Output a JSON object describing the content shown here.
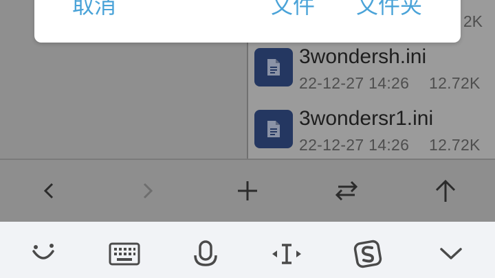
{
  "dialog": {
    "cancel_label": "取消",
    "file_label": "文件",
    "folder_label": "文件夹"
  },
  "file_list": {
    "partial_size": "2K",
    "items": [
      {
        "name": "3wondersh.ini",
        "date": "22-12-27 14:26",
        "size": "12.72K",
        "icon": "document-icon"
      },
      {
        "name": "3wondersr1.ini",
        "date": "22-12-27 14:26",
        "size": "12.72K",
        "icon": "document-icon"
      }
    ]
  },
  "toolbar": {
    "buttons": [
      "back-icon",
      "forward-icon",
      "add-icon",
      "swap-icon",
      "up-arrow-icon"
    ]
  },
  "keyboard_bar": {
    "buttons": [
      "emoji-icon",
      "keyboard-icon",
      "microphone-icon",
      "cursor-icon",
      "sogou-logo-icon",
      "chevron-down-icon"
    ]
  },
  "colors": {
    "accent": "#4aa3d8",
    "file_icon_bg": "#243761",
    "keyboard_bar_bg": "#f1f3f6"
  }
}
